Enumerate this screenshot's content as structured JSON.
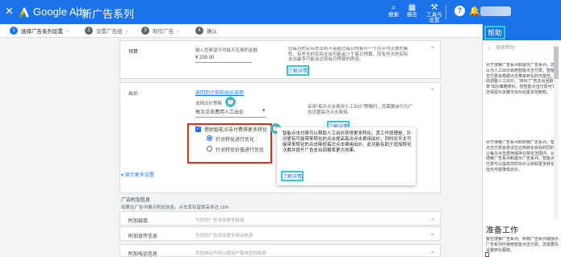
{
  "header": {
    "app_name": "Google Ads",
    "page_title": "新广告系列",
    "tools": [
      {
        "icon": "search-icon",
        "label": "搜索"
      },
      {
        "icon": "report-icon",
        "label": "报告"
      },
      {
        "icon": "tools-icon",
        "label": "工具与设置"
      }
    ]
  },
  "stepper": [
    {
      "num": "1",
      "label": "选择广告系列设置"
    },
    {
      "num": "2",
      "label": "设置广告组"
    },
    {
      "num": "3",
      "label": "制作广告"
    },
    {
      "num": "4",
      "label": "确认"
    }
  ],
  "budget": {
    "label": "预算",
    "hint": "输入您希望平均每天花费的金额",
    "value": "¥ 200.00",
    "right_text": "您每月的实际支出将不会超过每日预算与一个月平均天数的乘积。有些天的实际支出可能会少于每日预算，而有些天的实际支出最多可能会达到每日预算的两倍。",
    "learn_more": "了解详情"
  },
  "bidding": {
    "label": "出价",
    "back_link": "返回到之前的出价选项",
    "strategy_label": "选择出价策略",
    "strategy_value": "每次点击费用人工出价",
    "right_text": "采用\"每次点击费用人工出价\"策略时，您需要自行为广告设置每次点击费用。",
    "learn_more": "了解详情",
    "enhanced_checkbox": "借助智能点击付费得更多转化",
    "options": [
      "针对转化进行优化",
      "针对转化价值进行优化"
    ],
    "show_more": "显示更多设置"
  },
  "tooltip": {
    "text": "智能点击付费可以帮助人工出价获得更多转化。其工作原理是，针对更有可能带来转化的点击提高每次点击费用出价，同时对不太可能带来转化的点击降低每次点击费用出价。此功能有助于增加转化次数并提升广告支出回报率更大效果。",
    "learn_more": "了解详情"
  },
  "extensions": {
    "title": "广告附加信息",
    "subtitle": "如果在广告中展示附加信息，点击率有望提高多达 15%",
    "rows": [
      {
        "label": "附加链接",
        "placeholder": "为您的广告添加更多链接"
      },
      {
        "label": "附加宣传信息",
        "placeholder": "为您的广告添加更多商业信息"
      },
      {
        "label": "附加电话信息",
        "placeholder": "添加电话号码以便用户致电您的商家"
      }
    ]
  },
  "help": {
    "title": "帮助",
    "search_placeholder": "搜索帮助",
    "section_title": "准备工作",
    "para1": "对于搜索广告系列和展示广告系列，您可以为人工出价启用智能点击付费。智能点击付费会根据点击带来转化的可能性，自动调整人工出价。\"目标\"广告支出回报率\"出价策略类似，但智能点击付费可为您保留对关键字出价的更多控制权。",
    "para2": "对于搜索广告系列和购物广告系列，智能点击付费会尝试在达到转化目标的同时，让每次点击费用保持在特定范围内。对于搜索广告系列和展示广告系列，智能点击付费可以提高您的出价以获取更多转化，但也可能降低出价。",
    "para3": "要在搜索广告系列、购物广告系列或展示广告系列中使用智能点击付费，您需要先设置转化跟踪。"
  }
}
